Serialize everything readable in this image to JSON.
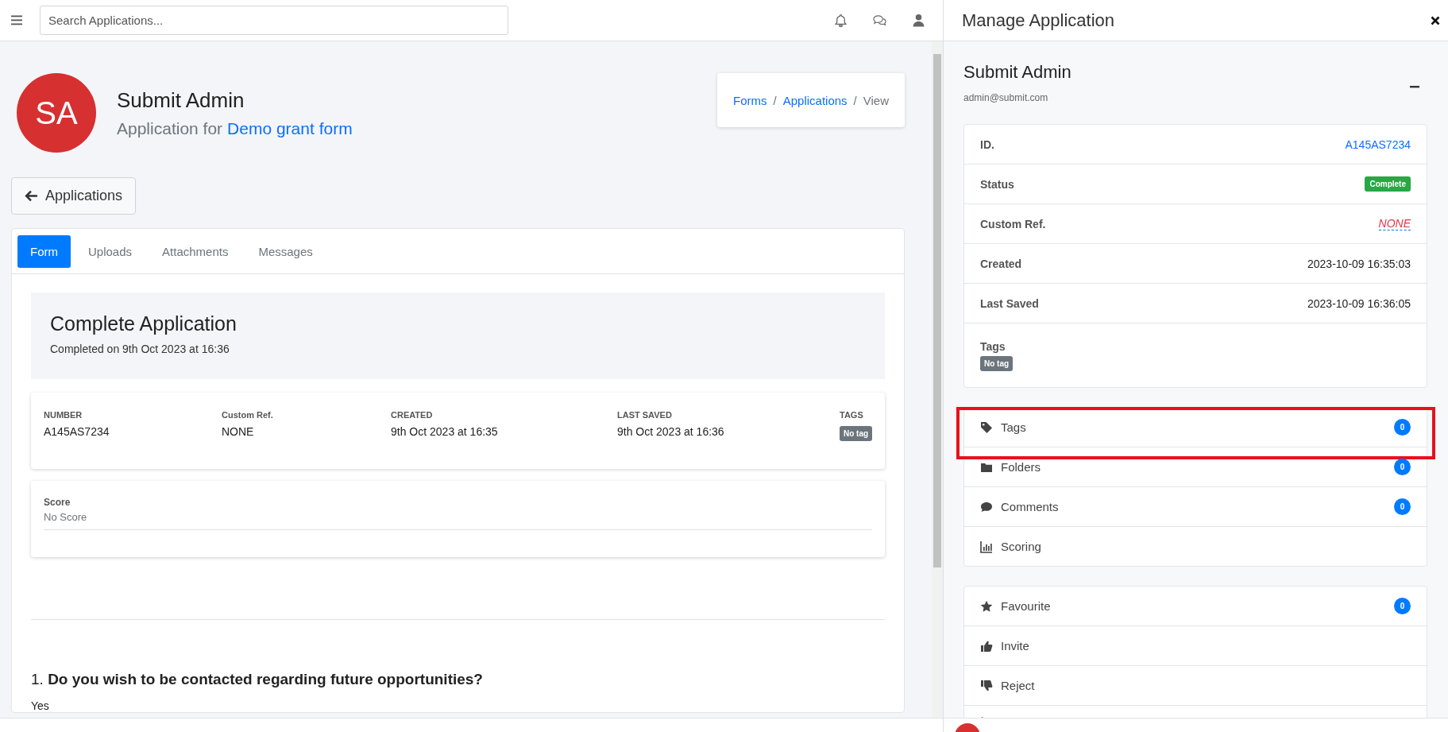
{
  "topbar": {
    "search": {
      "placeholder": "Search Applications..."
    }
  },
  "profile": {
    "initials": "SA",
    "name": "Submit Admin",
    "subtitle": "Application for",
    "form_link": "Demo grant form"
  },
  "breadcrumb": [
    {
      "label": "Forms",
      "kind": "link"
    },
    {
      "label": "/",
      "kind": "separator"
    },
    {
      "label": "Applications",
      "kind": "link"
    },
    {
      "label": "/",
      "kind": "separator"
    },
    {
      "label": "View",
      "kind": "current"
    }
  ],
  "back_button": "Applications",
  "tabs": [
    {
      "label": "Form",
      "selected": true
    },
    {
      "label": "Uploads",
      "selected": false
    },
    {
      "label": "Attachments",
      "selected": false
    },
    {
      "label": "Messages",
      "selected": false
    }
  ],
  "summary": {
    "title": "Complete Application",
    "subtitle": "Completed on 9th Oct 2023 at 16:36"
  },
  "info_fields": [
    {
      "label": "NUMBER",
      "value": "A145AS7234",
      "kind": "text"
    },
    {
      "label": "Custom Ref.",
      "value": "NONE",
      "kind": "text"
    },
    {
      "label": "CREATED",
      "value": "9th Oct 2023 at 16:35",
      "kind": "text"
    },
    {
      "label": "LAST SAVED",
      "value": "9th Oct 2023 at 16:36",
      "kind": "text"
    },
    {
      "label": "TAGS",
      "value": "No tag",
      "kind": "badge"
    }
  ],
  "score": {
    "label": "Score",
    "value": "No Score"
  },
  "question": {
    "number": "1.",
    "text": "Do you wish to be contacted regarding future opportunities?",
    "answer": "Yes"
  },
  "panel": {
    "title": "Manage Application",
    "user": {
      "name": "Submit Admin",
      "email": "admin@submit.com"
    },
    "details": [
      {
        "label": "ID.",
        "value": "A145AS7234",
        "kind": "link"
      },
      {
        "label": "Status",
        "value": "Complete",
        "kind": "status"
      },
      {
        "label": "Custom Ref.",
        "value": "NONE",
        "kind": "empty"
      },
      {
        "label": "Created",
        "value": "2023-10-09 16:35:03",
        "kind": "text"
      },
      {
        "label": "Last Saved",
        "value": "2023-10-09 16:36:05",
        "kind": "text"
      },
      {
        "label": "Tags",
        "value": "No tag",
        "kind": "tags"
      }
    ],
    "action_groups": [
      [
        {
          "label": "Tags",
          "count": "0",
          "highlighted": true
        },
        {
          "label": "Folders",
          "count": "0",
          "highlighted": false
        },
        {
          "label": "Comments",
          "count": "0",
          "highlighted": false
        },
        {
          "label": "Scoring",
          "highlighted": false
        }
      ],
      [
        {
          "label": "Favourite",
          "count": "0",
          "highlighted": false
        },
        {
          "label": "Invite",
          "highlighted": false
        },
        {
          "label": "Reject",
          "highlighted": false
        }
      ]
    ]
  }
}
